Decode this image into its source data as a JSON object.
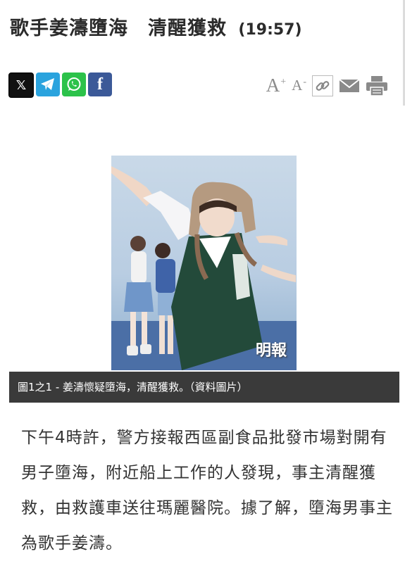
{
  "article": {
    "title": "歌手姜濤墮海　清醒獲救",
    "time": "(19:57)"
  },
  "share_buttons": [
    {
      "name": "x-icon",
      "glyph": "𝕏",
      "color": "#111111"
    },
    {
      "name": "telegram-icon",
      "glyph": "",
      "color": "#2aa3de"
    },
    {
      "name": "whatsapp-icon",
      "glyph": "",
      "color": "#2cc24a"
    },
    {
      "name": "facebook-icon",
      "glyph": "f",
      "color": "#3b5998"
    }
  ],
  "tools": {
    "font_increase": "A",
    "font_increase_sup": "+",
    "font_decrease": "A",
    "font_decrease_sup": "-"
  },
  "image": {
    "watermark": "明報",
    "caption": "圖1之1 - 姜濤懷疑墮海，清醒獲救。（資料圖片）"
  },
  "body": {
    "paragraph": "下午4時許，警方接報西區副食品批發市場對開有男子墮海，附近船上工作的人發現，事主清醒獲救，由救護車送往瑪麗醫院。據了解，墮海男事主為歌手姜濤。"
  }
}
